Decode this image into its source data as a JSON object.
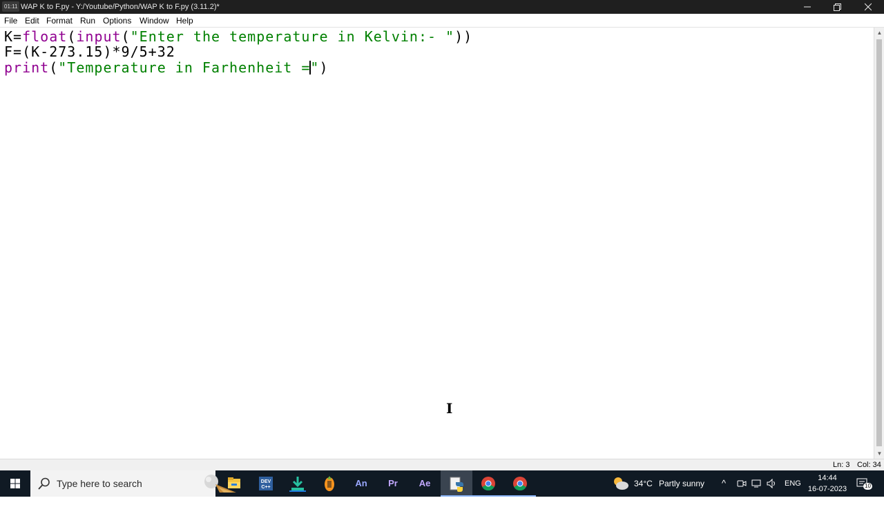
{
  "window": {
    "badge": "01:11",
    "title": "WAP K to F.py - Y:/Youtube/Python/WAP K to F.py (3.11.2)*",
    "minimize_icon": "minimize-icon",
    "restore_icon": "restore-icon",
    "close_icon": "close-icon"
  },
  "menu": {
    "items": [
      "File",
      "Edit",
      "Format",
      "Run",
      "Options",
      "Window",
      "Help"
    ]
  },
  "editor": {
    "lines": [
      [
        {
          "text": "K=",
          "kind": "plain"
        },
        {
          "text": "float",
          "kind": "keyword"
        },
        {
          "text": "(",
          "kind": "plain"
        },
        {
          "text": "input",
          "kind": "keyword"
        },
        {
          "text": "(",
          "kind": "plain"
        },
        {
          "text": "\"Enter the temperature in Kelvin:- \"",
          "kind": "string"
        },
        {
          "text": "))",
          "kind": "plain"
        }
      ],
      [
        {
          "text": "F=(K-273.15)*9/5+32",
          "kind": "plain"
        }
      ],
      [
        {
          "text": "print",
          "kind": "keyword"
        },
        {
          "text": "(",
          "kind": "plain"
        },
        {
          "text": "\"Temperature in Farhenheit =",
          "kind": "string"
        },
        {
          "text": "\"",
          "kind": "string"
        },
        {
          "text": ")",
          "kind": "plain"
        }
      ]
    ],
    "colors": {
      "keyword": "#900090",
      "string": "#008000",
      "plain": "#000000"
    }
  },
  "status": {
    "line": "Ln: 3",
    "col": "Col: 34"
  },
  "taskbar": {
    "search_placeholder": "Type here to search",
    "apps": [
      {
        "icon": "file-explorer-icon",
        "label": ""
      },
      {
        "icon": "dev-cpp-icon",
        "label": ""
      },
      {
        "icon": "download-app-icon",
        "label": ""
      },
      {
        "icon": "fl-studio-icon",
        "label": ""
      },
      {
        "icon": "animate-icon",
        "label": "An"
      },
      {
        "icon": "premiere-icon",
        "label": "Pr"
      },
      {
        "icon": "after-effects-icon",
        "label": "Ae"
      },
      {
        "icon": "python-idle-icon",
        "label": ""
      },
      {
        "icon": "chrome-icon",
        "label": ""
      },
      {
        "icon": "chrome-icon",
        "label": ""
      }
    ],
    "weather": {
      "temp": "34°C",
      "desc": "Partly sunny"
    },
    "language": "ENG",
    "time": "14:44",
    "date": "16-07-2023",
    "notifications": "10"
  }
}
